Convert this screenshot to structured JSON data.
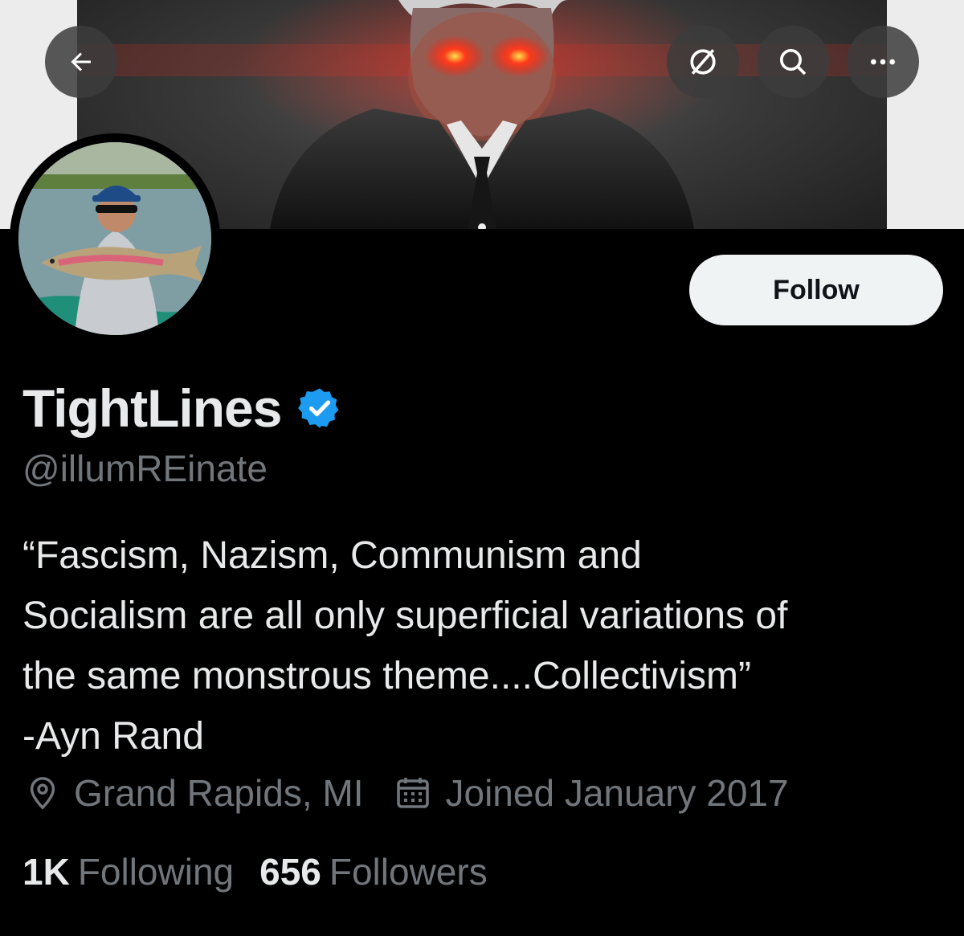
{
  "nav": {
    "back_icon": "arrow-left-icon",
    "mute_icon": "circle-slash-icon",
    "search_icon": "search-icon",
    "more_icon": "ellipsis-icon"
  },
  "profile": {
    "display_name": "TightLines",
    "verified": true,
    "handle": "@illumREinate",
    "bio": "“Fascism, Nazism, Communism and\nSocialism are all only superficial variations of\nthe same monstrous theme....Collectivism”\n-Ayn Rand",
    "location": "Grand Rapids, MI",
    "joined": "Joined January 2017",
    "following_count": "1K",
    "following_label": "Following",
    "followers_count": "656",
    "followers_label": "Followers"
  },
  "actions": {
    "follow_label": "Follow"
  },
  "colors": {
    "background": "#000000",
    "text_primary": "#e7e9ea",
    "text_secondary": "#71767b",
    "verified_blue": "#1d9bf0",
    "follow_bg": "#eff3f4",
    "laser_red": "#ff2a1a"
  }
}
